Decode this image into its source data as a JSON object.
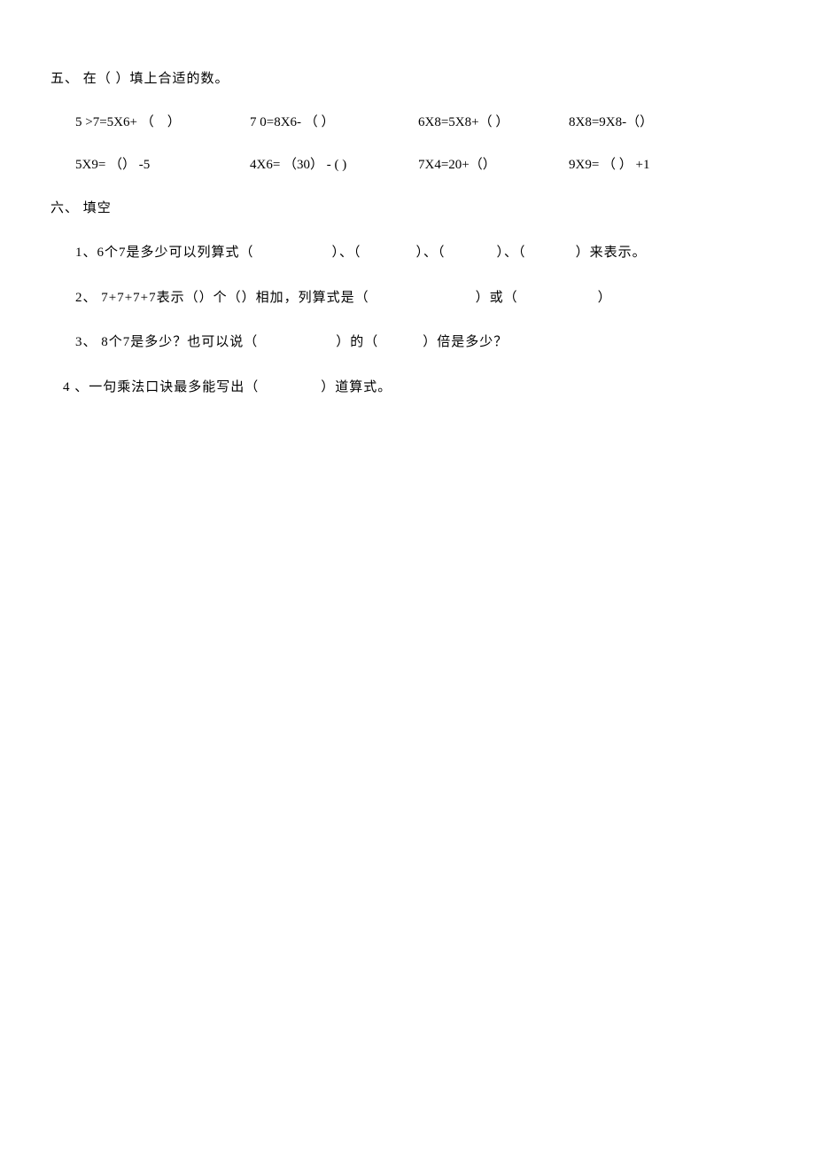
{
  "section5": {
    "header": "五、 在（ ）填上合适的数。",
    "row1": {
      "c1": "5 >7=5X6+ （　）",
      "c2": "7 0=8X6- （ ）",
      "c3": "6X8=5X8+（ ）",
      "c4": "8X8=9X8-（）"
    },
    "row2": {
      "c1": "5X9= （） -5",
      "c2": "4X6= （30） - ( )",
      "c3": "7X4=20+（）",
      "c4": "9X9= （ ） +1"
    }
  },
  "section6": {
    "header": "六、 填空",
    "q1": {
      "p1": "1、6个7是多少可以列算式（",
      "p2": "）、（",
      "p3": "）、（",
      "p4": "）、（",
      "p5": "）来表示。"
    },
    "q2": {
      "p1": "2、 7+7+7+7表示（）个（）相加，列算式是（",
      "p2": "）或（",
      "p3": "）"
    },
    "q3": {
      "p1": "3、 8个7是多少？也可以说（",
      "p2": "）的（",
      "p3": "）倍是多少？"
    },
    "q4": {
      "p1": "4 、一句乘法口诀最多能写出（",
      "p2": "）道算式。"
    }
  }
}
